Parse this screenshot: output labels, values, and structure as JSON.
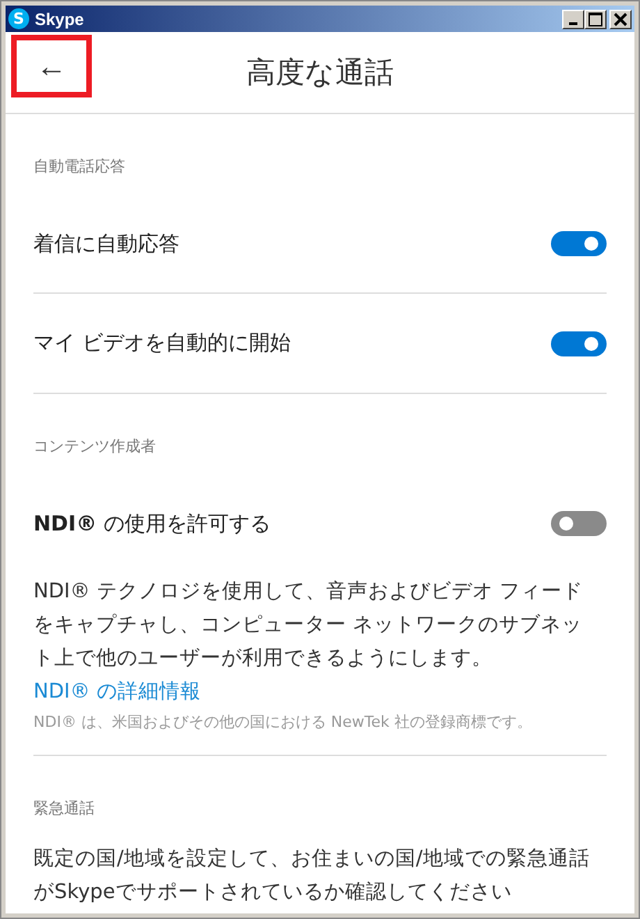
{
  "window": {
    "title": "Skype",
    "logo_letter": "S"
  },
  "header": {
    "back": "←",
    "back_highlighted": true,
    "title": "高度な通話"
  },
  "sections": [
    {
      "label": "自動電話応答",
      "items": [
        {
          "kind": "toggle",
          "label": "着信に自動応答",
          "on": true
        },
        {
          "kind": "toggle",
          "label": "マイ ビデオを自動的に開始",
          "on": true
        }
      ]
    },
    {
      "label": "コンテンツ作成者",
      "items": [
        {
          "kind": "toggle",
          "label": "**NDI®** の使用を許可する",
          "on": false
        },
        {
          "kind": "paragraph",
          "text": "NDI® テクノロジを使用して、音声およびビデオ フィードをキャプチャし、コンピューター ネットワークのサブネット上で他のユーザーが利用できるようにします。"
        },
        {
          "kind": "link",
          "text": "NDI® の詳細情報"
        },
        {
          "kind": "note",
          "text": "NDI® は、米国およびその他の国における NewTek 社の登録商標です。"
        }
      ]
    },
    {
      "label": "緊急通話",
      "items": [
        {
          "kind": "paragraph",
          "text": "既定の国/地域を設定して、お住まいの国/地域での緊急通話がSkypeでサポートされているか確認してください"
        }
      ]
    }
  ]
}
